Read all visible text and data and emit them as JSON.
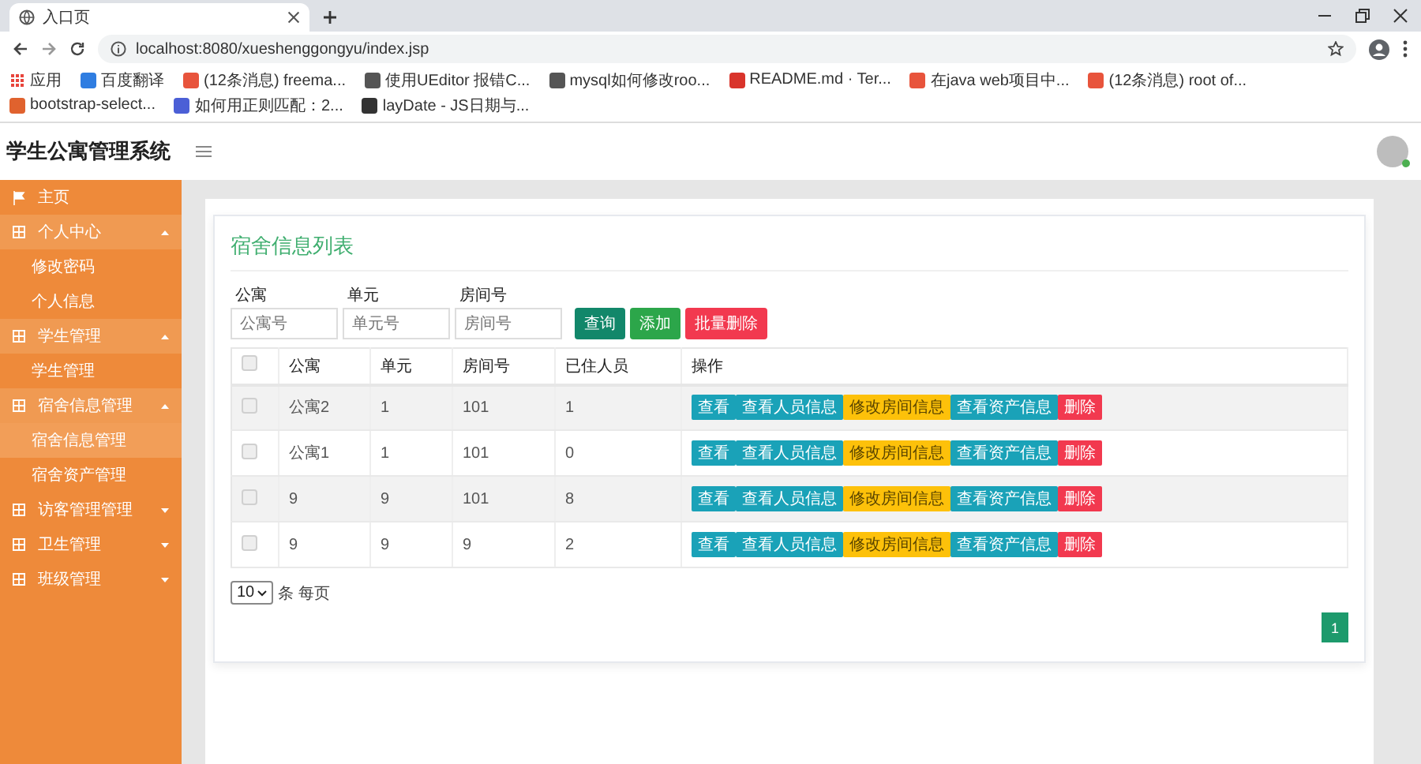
{
  "browser": {
    "tab": {
      "title": "入口页"
    },
    "address": "localhost:8080/xueshenggongyu/index.jsp",
    "bookmarks": [
      {
        "label": "应用",
        "kind": "apps",
        "color": "#e8453c"
      },
      {
        "label": "百度翻译",
        "kind": "page",
        "color": "#2f7de1"
      },
      {
        "label": "(12条消息) freema...",
        "kind": "page",
        "color": "#e8543c"
      },
      {
        "label": "使用UEditor 报错C...",
        "kind": "page",
        "color": "#555555"
      },
      {
        "label": "mysql如何修改roo...",
        "kind": "page",
        "color": "#555555"
      },
      {
        "label": "README.md · Ter...",
        "kind": "page",
        "color": "#d9342b"
      },
      {
        "label": "在java web项目中...",
        "kind": "page",
        "color": "#e8543c"
      },
      {
        "label": "(12条消息) root of...",
        "kind": "page",
        "color": "#e8543c"
      },
      {
        "label": "bootstrap-select...",
        "kind": "page",
        "color": "#e0622e"
      },
      {
        "label": "如何用正则匹配：2...",
        "kind": "page",
        "color": "#4b5fd6"
      },
      {
        "label": "layDate - JS日期与...",
        "kind": "page",
        "color": "#333333"
      }
    ]
  },
  "header": {
    "title": "学生公寓管理系统",
    "avatar": {
      "online": true
    }
  },
  "sidebar": {
    "items": [
      {
        "label": "主页",
        "kind": "link",
        "selected": false
      },
      {
        "label": "个人中心",
        "kind": "group",
        "expanded": true,
        "children": [
          {
            "label": "修改密码",
            "selected": false
          },
          {
            "label": "个人信息",
            "selected": false
          }
        ]
      },
      {
        "label": "学生管理",
        "kind": "group",
        "expanded": true,
        "children": [
          {
            "label": "学生管理",
            "selected": false
          }
        ]
      },
      {
        "label": "宿舍信息管理",
        "kind": "group",
        "expanded": true,
        "children": [
          {
            "label": "宿舍信息管理",
            "selected": true
          },
          {
            "label": "宿舍资产管理",
            "selected": false
          }
        ]
      },
      {
        "label": "访客管理管理",
        "kind": "group",
        "expanded": false
      },
      {
        "label": "卫生管理",
        "kind": "group",
        "expanded": false
      },
      {
        "label": "班级管理",
        "kind": "group",
        "expanded": false
      }
    ]
  },
  "card": {
    "title": "宿舍信息列表",
    "filters": [
      {
        "label": "公寓",
        "placeholder": "公寓号"
      },
      {
        "label": "单元",
        "placeholder": "单元号"
      },
      {
        "label": "房间号",
        "placeholder": "房间号"
      }
    ],
    "buttons": [
      {
        "label": "查询",
        "kind": "search"
      },
      {
        "label": "添加",
        "kind": "add"
      },
      {
        "label": "批量删除",
        "kind": "danger"
      }
    ]
  },
  "table": {
    "select_all": {
      "checked": false
    },
    "columns": [
      "公寓",
      "单元",
      "房间号",
      "已住人员",
      "操作"
    ],
    "rows": [
      {
        "checked": false,
        "cells": [
          "公寓2",
          "1",
          "101",
          "1"
        ],
        "actions": [
          {
            "label": "查看",
            "kind": "info"
          },
          {
            "label": "查看人员信息",
            "kind": "info"
          },
          {
            "label": "修改房间信息",
            "kind": "warning"
          },
          {
            "label": "查看资产信息",
            "kind": "info"
          },
          {
            "label": "删除",
            "kind": "danger"
          }
        ]
      },
      {
        "checked": false,
        "cells": [
          "公寓1",
          "1",
          "101",
          "0"
        ],
        "actions": [
          {
            "label": "查看",
            "kind": "info"
          },
          {
            "label": "查看人员信息",
            "kind": "info"
          },
          {
            "label": "修改房间信息",
            "kind": "warning"
          },
          {
            "label": "查看资产信息",
            "kind": "info"
          },
          {
            "label": "删除",
            "kind": "danger"
          }
        ]
      },
      {
        "checked": false,
        "cells": [
          "9",
          "9",
          "101",
          "8"
        ],
        "actions": [
          {
            "label": "查看",
            "kind": "info"
          },
          {
            "label": "查看人员信息",
            "kind": "info"
          },
          {
            "label": "修改房间信息",
            "kind": "warning"
          },
          {
            "label": "查看资产信息",
            "kind": "info"
          },
          {
            "label": "删除",
            "kind": "danger"
          }
        ]
      },
      {
        "checked": false,
        "cells": [
          "9",
          "9",
          "9",
          "2"
        ],
        "actions": [
          {
            "label": "查看",
            "kind": "info"
          },
          {
            "label": "查看人员信息",
            "kind": "info"
          },
          {
            "label": "修改房间信息",
            "kind": "warning"
          },
          {
            "label": "查看资产信息",
            "kind": "info"
          },
          {
            "label": "删除",
            "kind": "danger"
          }
        ]
      }
    ]
  },
  "pagination": {
    "page_size": "10",
    "page_size_label": "条 每页",
    "pages": [
      {
        "label": "1",
        "selected": true
      }
    ]
  }
}
